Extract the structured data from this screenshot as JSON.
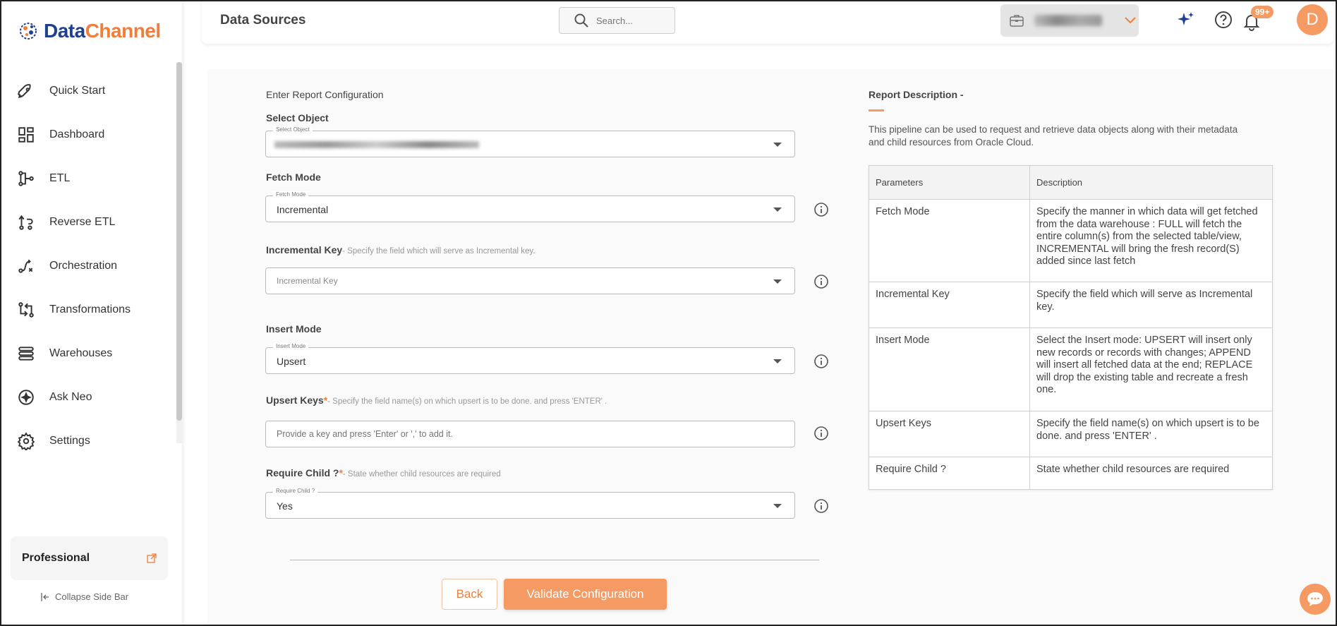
{
  "app": {
    "logo_text_1": "Data",
    "logo_text_2": "Channel"
  },
  "sidebar": {
    "items": [
      {
        "label": "Quick Start",
        "icon": "rocket-icon"
      },
      {
        "label": "Dashboard",
        "icon": "dashboard-icon"
      },
      {
        "label": "ETL",
        "icon": "etl-icon"
      },
      {
        "label": "Reverse ETL",
        "icon": "reverse-etl-icon"
      },
      {
        "label": "Orchestration",
        "icon": "orchestration-icon"
      },
      {
        "label": "Transformations",
        "icon": "transformations-icon"
      },
      {
        "label": "Warehouses",
        "icon": "warehouses-icon"
      },
      {
        "label": "Ask Neo",
        "icon": "ask-neo-icon"
      },
      {
        "label": "Settings",
        "icon": "gear-icon"
      }
    ],
    "plan": "Professional",
    "collapse_label": "Collapse Side Bar"
  },
  "header": {
    "title": "Data Sources",
    "search_placeholder": "Search...",
    "notification_count": "99+",
    "avatar_letter": "D"
  },
  "form": {
    "section_title": "Enter Report Configuration",
    "select_object": {
      "label": "Select Object",
      "float_label": "Select Object"
    },
    "fetch_mode": {
      "label": "Fetch Mode",
      "float_label": "Fetch Mode",
      "value": "Incremental"
    },
    "incremental_key": {
      "label": "Incremental Key",
      "hint": "- Specify the field which will serve as Incremental key.",
      "placeholder": "Incremental Key"
    },
    "insert_mode": {
      "label": "Insert Mode",
      "float_label": "Insert Mode",
      "value": "Upsert"
    },
    "upsert_keys": {
      "label": "Upsert Keys",
      "required_mark": "*",
      "hint": "- Specify the field name(s) on which upsert is to be done. and press 'ENTER' .",
      "placeholder": "Provide a key and press 'Enter' or ',' to add it."
    },
    "require_child": {
      "label": "Require Child ?",
      "required_mark": "*",
      "hint": "- State whether child resources are required",
      "float_label": "Require Child ?",
      "value": "Yes"
    },
    "back_label": "Back",
    "validate_label": "Validate Configuration"
  },
  "report": {
    "title": "Report Description -",
    "description": "This pipeline can be used to request and retrieve data objects along with their metadata and child resources from Oracle Cloud.",
    "table": {
      "headers": [
        "Parameters",
        "Description"
      ],
      "rows": [
        {
          "param": "Fetch Mode",
          "desc": "Specify the manner in which data will get fetched from the data warehouse : FULL will fetch the entire column(s) from the selected table/view, INCREMENTAL will bring the fresh record(S) added since last fetch"
        },
        {
          "param": "Incremental Key",
          "desc": "Specify the field which will serve as Incremental key."
        },
        {
          "param": "Insert Mode",
          "desc": "Select the Insert mode: UPSERT will insert only new records or records with changes; APPEND will insert all fetched data at the end; REPLACE will drop the existing table and recreate a fresh one."
        },
        {
          "param": "Upsert Keys",
          "desc": "Specify the field name(s) on which upsert is to be done. and press 'ENTER' ."
        },
        {
          "param": "Require Child ?",
          "desc": "State whether child resources are required"
        }
      ]
    }
  },
  "colors": {
    "accent": "#f49a62",
    "brand_blue": "#1f3f8f"
  }
}
